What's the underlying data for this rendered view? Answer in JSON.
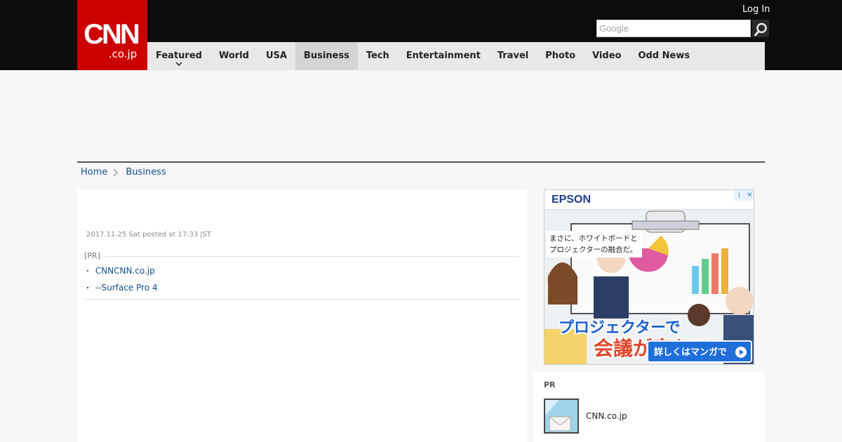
{
  "header": {
    "logo_main": "CNN",
    "logo_sub": ".co.jp",
    "login_label": "Log In",
    "search_placeholder": "Google",
    "nav": [
      {
        "label": "Featured"
      },
      {
        "label": "World"
      },
      {
        "label": "USA"
      },
      {
        "label": "Business"
      },
      {
        "label": "Tech"
      },
      {
        "label": "Entertainment"
      },
      {
        "label": "Travel"
      },
      {
        "label": "Photo"
      },
      {
        "label": "Video"
      },
      {
        "label": "Odd News"
      }
    ],
    "active_nav": "Business",
    "brand_color": "#cc0000"
  },
  "breadcrumb": {
    "home": "Home",
    "current": "Business"
  },
  "article": {
    "posted": "2017.11.25 Sat posted at 17:33 JST",
    "pr_label": "[PR]",
    "pr_links": [
      {
        "bullet": "・",
        "text": "CNNCNN.co.jp"
      },
      {
        "bullet": "・",
        "text": "--Surface Pro 4"
      }
    ]
  },
  "ad": {
    "brand": "EPSON",
    "copy_line1": "まさに、ホワイトボードと",
    "copy_line2": "プロジェクターの融合だ。",
    "headline1": "プロジェクターで",
    "headline2": "会議が変わる",
    "cta": "詳しくはマンガで"
  },
  "side_pr": {
    "title": "PR",
    "item_text": "CNN.co.jp"
  }
}
